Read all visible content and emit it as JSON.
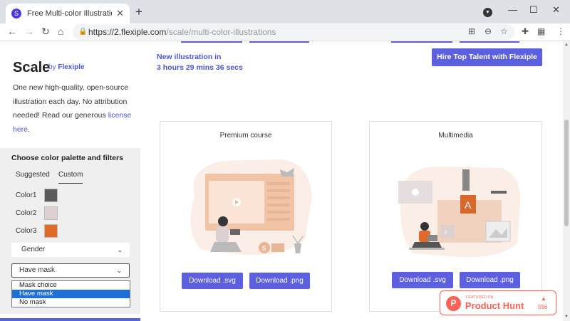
{
  "browser": {
    "tab_title": "Free Multi-color Illustrations fo",
    "tab_favicon": "S",
    "close_tab": "✕",
    "new_tab": "+",
    "url_host": "https://2.flexiple.com",
    "url_path": "/scale/multi-color-illustrations"
  },
  "sidebar": {
    "brand": "Scale",
    "by": "by ",
    "by_company": "Flexiple",
    "desc_text": "One new high-quality, open-source illustration each day. No attribution needed! Read our generous ",
    "license_link": "license here",
    "desc_end": "."
  },
  "filters": {
    "heading": "Choose color palette and filters",
    "tabs": [
      "Suggested",
      "Custom"
    ],
    "active_tab": "Custom",
    "colors": [
      {
        "label": "Color1",
        "hex": "#5a5a5a"
      },
      {
        "label": "Color2",
        "hex": "#dcd0d0"
      },
      {
        "label": "Color3",
        "hex": "#e06a2a"
      }
    ],
    "gender_select": "Gender",
    "mask_select": "Have mask",
    "mask_options": [
      "Mask choice",
      "Have mask",
      "No mask"
    ],
    "mask_selected": "Have mask"
  },
  "main": {
    "new_illustration_line1": "New illustration in",
    "new_illustration_line2": "3 hours 29 mins 36 secs",
    "hire_button": "Hire Top Talent with Flexiple",
    "cards": [
      {
        "title": "Premium course",
        "download_svg": "Download .svg",
        "download_png": "Download .png"
      },
      {
        "title": "Multimedia",
        "download_svg": "Download .svg",
        "download_png": "Download .png"
      }
    ]
  },
  "product_hunt": {
    "featured": "FEATURED ON",
    "name": "Product Hunt",
    "upvotes": "556"
  },
  "colors": {
    "accent": "#5c5fe0",
    "link": "#4b56d6",
    "product_hunt": "#ff6154",
    "illustration_orange": "#e8b597"
  }
}
